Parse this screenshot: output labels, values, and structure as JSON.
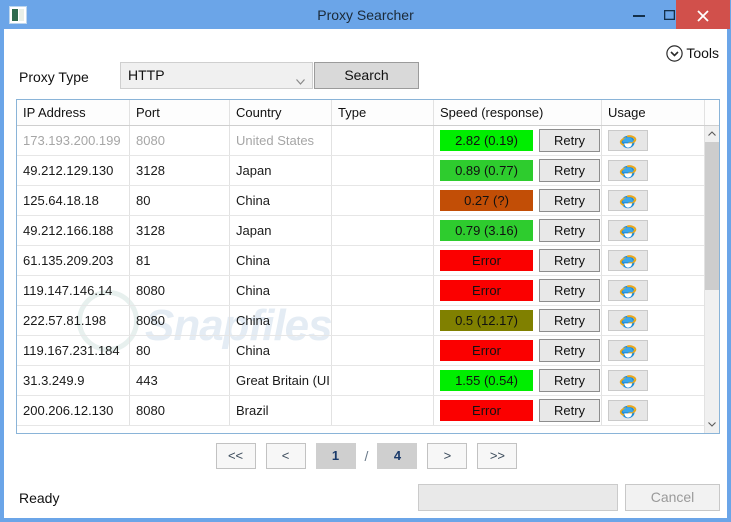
{
  "window": {
    "title": "Proxy Searcher",
    "app_icon": "app-icon",
    "minimize_label": "–",
    "maximize_label": "□",
    "close_label": "✕",
    "border_color": "#6ba5e8",
    "close_color": "#d1504b"
  },
  "toolbar": {
    "tools_label": "Tools",
    "tools_icon": "chevron-down-circle-icon"
  },
  "search": {
    "proxy_type_label": "Proxy Type",
    "proxy_type_value": "HTTP",
    "proxy_type_options": [
      "HTTP"
    ],
    "search_label": "Search"
  },
  "grid": {
    "columns": [
      "IP Address",
      "Port",
      "Country",
      "Type",
      "Speed (response)",
      "Usage"
    ],
    "retry_label": "Retry",
    "usage_icon": "internet-explorer-icon",
    "rows": [
      {
        "ip": "173.193.200.199",
        "port": "8080",
        "country": "United States",
        "type": "",
        "speed": "2.82 (0.19)",
        "speed_color": "#00ee00",
        "dim": true
      },
      {
        "ip": "49.212.129.130",
        "port": "3128",
        "country": "Japan",
        "type": "",
        "speed": "0.89 (0.77)",
        "speed_color": "#2ecc2e",
        "dim": false
      },
      {
        "ip": "125.64.18.18",
        "port": "80",
        "country": "China",
        "type": "",
        "speed": "0.27 (?)",
        "speed_color": "#c24e06",
        "dim": false
      },
      {
        "ip": "49.212.166.188",
        "port": "3128",
        "country": "Japan",
        "type": "",
        "speed": "0.79 (3.16)",
        "speed_color": "#2ecc2e",
        "dim": false
      },
      {
        "ip": "61.135.209.203",
        "port": "81",
        "country": "China",
        "type": "",
        "speed": "Error",
        "speed_color": "#fb0000",
        "dim": false
      },
      {
        "ip": "119.147.146.14",
        "port": "8080",
        "country": "China",
        "type": "",
        "speed": "Error",
        "speed_color": "#fb0000",
        "dim": false
      },
      {
        "ip": "222.57.81.198",
        "port": "8080",
        "country": "China",
        "type": "",
        "speed": "0.5 (12.17)",
        "speed_color": "#808000",
        "dim": false
      },
      {
        "ip": "119.167.231.184",
        "port": "80",
        "country": "China",
        "type": "",
        "speed": "Error",
        "speed_color": "#fb0000",
        "dim": false
      },
      {
        "ip": "31.3.249.9",
        "port": "443",
        "country": "Great Britain (UI",
        "type": "",
        "speed": "1.55 (0.54)",
        "speed_color": "#00ee00",
        "dim": false
      },
      {
        "ip": "200.206.12.130",
        "port": "8080",
        "country": "Brazil",
        "type": "",
        "speed": "Error",
        "speed_color": "#fb0000",
        "dim": false
      }
    ]
  },
  "pager": {
    "first_label": "<<",
    "prev_label": "<",
    "current_page": "1",
    "separator": "/",
    "total_pages": "4",
    "next_label": ">",
    "last_label": ">>"
  },
  "statusbar": {
    "status_text": "Ready",
    "cancel_label": "Cancel",
    "progress_value": ""
  },
  "watermark": {
    "text": "Snapfiles"
  }
}
